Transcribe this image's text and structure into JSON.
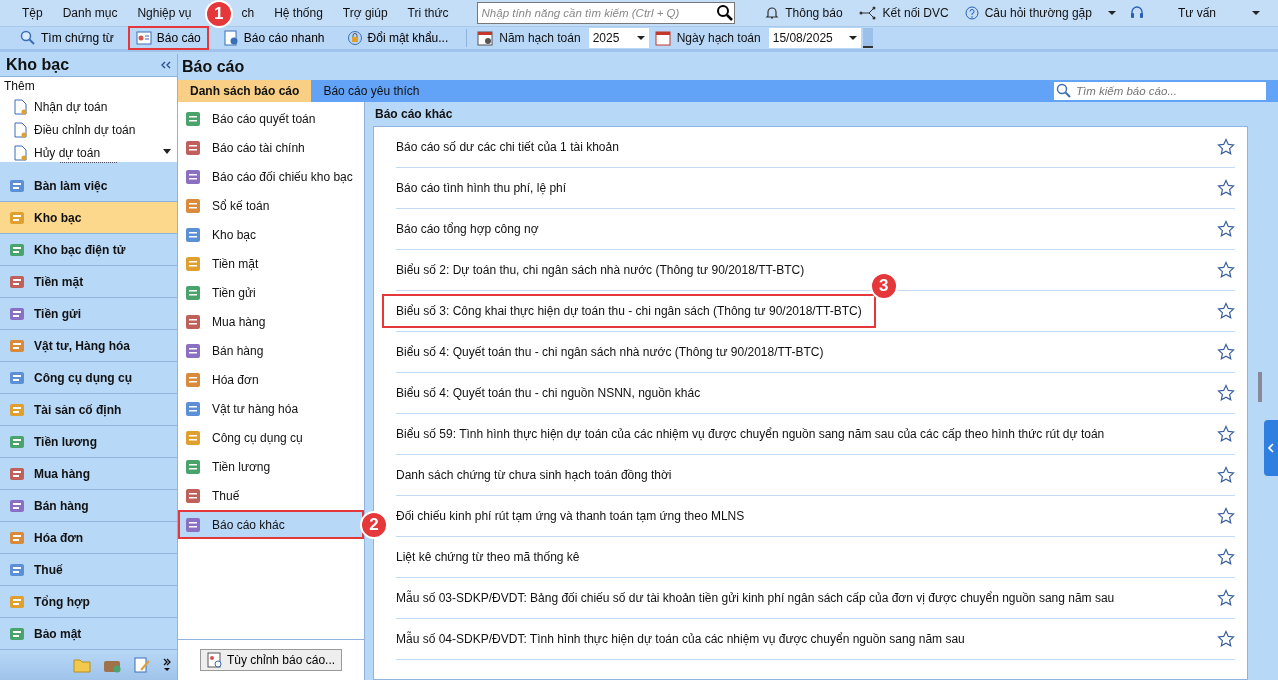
{
  "menu": [
    {
      "label": "Tệp"
    },
    {
      "label": "Danh mục"
    },
    {
      "label": "Nghiệp vụ"
    },
    {
      "label": "ch"
    },
    {
      "label": "Hệ thống"
    },
    {
      "label": "Trợ giúp"
    },
    {
      "label": "Tri thức"
    }
  ],
  "feature_search": {
    "placeholder": "Nhập tính năng cần tìm kiếm (Ctrl + Q)"
  },
  "top_right": [
    {
      "kind": "bell",
      "label": "Thông báo"
    },
    {
      "kind": "network",
      "label": "Kết nối DVC"
    },
    {
      "kind": "help",
      "label": "Câu hỏi thường gặp",
      "dropdown": true
    },
    {
      "kind": "headset",
      "label": "Tư vấn",
      "dropdown": true
    }
  ],
  "toolbar": [
    {
      "kind": "search",
      "label": "Tìm chứng từ",
      "highlighted": false
    },
    {
      "kind": "report",
      "label": "Báo cáo",
      "highlighted": true,
      "marker": "1"
    },
    {
      "kind": "quick",
      "label": "Báo cáo nhanh",
      "highlighted": false
    },
    {
      "kind": "lock",
      "label": "Đổi mật khẩu...",
      "highlighted": false
    }
  ],
  "fiscal_year": {
    "label": "Năm hạch toán",
    "value": "2025"
  },
  "posting_date": {
    "label": "Ngày hạch toán",
    "value": "15/08/2025"
  },
  "sidebar": {
    "title": "Kho bạc",
    "more_label": "Thêm",
    "quick_actions": [
      "Nhận dự toán",
      "Điều chỉnh dự toán",
      "Hủy dự toán"
    ],
    "items": [
      {
        "label": "Bàn làm việc",
        "selected": false
      },
      {
        "label": "Kho bạc",
        "selected": true
      },
      {
        "label": "Kho bạc điện tử",
        "selected": false
      },
      {
        "label": "Tiền mặt",
        "selected": false
      },
      {
        "label": "Tiền gửi",
        "selected": false
      },
      {
        "label": "Vật tư, Hàng hóa",
        "selected": false
      },
      {
        "label": "Công cụ dụng cụ",
        "selected": false
      },
      {
        "label": "Tài sản cố định",
        "selected": false
      },
      {
        "label": "Tiền lương",
        "selected": false
      },
      {
        "label": "Mua hàng",
        "selected": false
      },
      {
        "label": "Bán hàng",
        "selected": false
      },
      {
        "label": "Hóa đơn",
        "selected": false
      },
      {
        "label": "Thuế",
        "selected": false
      },
      {
        "label": "Tổng hợp",
        "selected": false
      },
      {
        "label": "Bảo mật",
        "selected": false
      }
    ]
  },
  "page_title": "Báo cáo",
  "tabs": [
    {
      "label": "Danh sách báo cáo",
      "selected": true
    },
    {
      "label": "Báo cáo yêu thích",
      "selected": false
    }
  ],
  "report_search": {
    "placeholder": "Tìm kiếm báo cáo..."
  },
  "categories": [
    {
      "label": "Báo cáo quyết toán",
      "selected": false,
      "highlighted": false
    },
    {
      "label": "Báo cáo tài chính",
      "selected": false,
      "highlighted": false
    },
    {
      "label": "Báo cáo đối chiếu kho bạc",
      "selected": false,
      "highlighted": false
    },
    {
      "label": "Sổ kế toán",
      "selected": false,
      "highlighted": false
    },
    {
      "label": "Kho bạc",
      "selected": false,
      "highlighted": false
    },
    {
      "label": "Tiền mặt",
      "selected": false,
      "highlighted": false
    },
    {
      "label": "Tiền gửi",
      "selected": false,
      "highlighted": false
    },
    {
      "label": "Mua hàng",
      "selected": false,
      "highlighted": false
    },
    {
      "label": "Bán hàng",
      "selected": false,
      "highlighted": false
    },
    {
      "label": "Hóa đơn",
      "selected": false,
      "highlighted": false
    },
    {
      "label": "Vật tư hàng hóa",
      "selected": false,
      "highlighted": false
    },
    {
      "label": "Công cụ dụng cụ",
      "selected": false,
      "highlighted": false
    },
    {
      "label": "Tiền lương",
      "selected": false,
      "highlighted": false
    },
    {
      "label": "Thuế",
      "selected": false,
      "highlighted": false
    },
    {
      "label": "Báo cáo khác",
      "selected": true,
      "highlighted": true,
      "marker": "2"
    }
  ],
  "customize_button": "Tùy chỉnh báo cáo...",
  "section_title": "Báo cáo khác",
  "reports": [
    {
      "name": "Báo cáo số dư các chi tiết của 1 tài khoản",
      "favorite": false,
      "highlighted": false
    },
    {
      "name": "Báo cáo tình hình thu phí, lệ phí",
      "favorite": false,
      "highlighted": false
    },
    {
      "name": "Báo cáo tổng hợp công nợ",
      "favorite": false,
      "highlighted": false
    },
    {
      "name": "Biểu số 2: Dự toán thu, chi ngân sách nhà nước (Thông tư 90/2018/TT-BTC)",
      "favorite": false,
      "highlighted": false
    },
    {
      "name": "Biểu số 3: Công khai thực hiện dự toán thu - chi ngân sách (Thông tư 90/2018/TT-BTC)",
      "favorite": false,
      "highlighted": true,
      "marker": "3"
    },
    {
      "name": "Biểu số 4: Quyết toán thu - chi ngân sách nhà nước (Thông tư 90/2018/TT-BTC)",
      "favorite": false,
      "highlighted": false
    },
    {
      "name": "Biểu số 4: Quyết toán thu - chi nguồn NSNN, nguồn khác",
      "favorite": false,
      "highlighted": false
    },
    {
      "name": "Biểu số 59: Tình hình thực hiện dự toán của các nhiệm vụ được chuyển nguồn sang năm sau của các cấp theo hình thức rút dự toán",
      "favorite": false,
      "highlighted": false
    },
    {
      "name": "Danh sách chứng từ chưa sinh hạch toán đồng thời",
      "favorite": false,
      "highlighted": false
    },
    {
      "name": "Đối chiếu kinh phí rút tạm ứng và thanh toán tạm ứng theo MLNS",
      "favorite": false,
      "highlighted": false
    },
    {
      "name": "Liệt kê chứng từ theo mã thống kê",
      "favorite": false,
      "highlighted": false
    },
    {
      "name": "Mẫu số 03-SDKP/ĐVDT: Bảng đối chiếu số dư tài khoản tiền gửi kinh phí ngân sách cấp của đơn vị được chuyển nguồn sang năm sau",
      "favorite": false,
      "highlighted": false
    },
    {
      "name": "Mẫu số 04-SDKP/ĐVDT: Tình hình thực hiện dự toán của các nhiệm vụ được chuyển nguồn sang năm sau",
      "favorite": false,
      "highlighted": false
    }
  ]
}
